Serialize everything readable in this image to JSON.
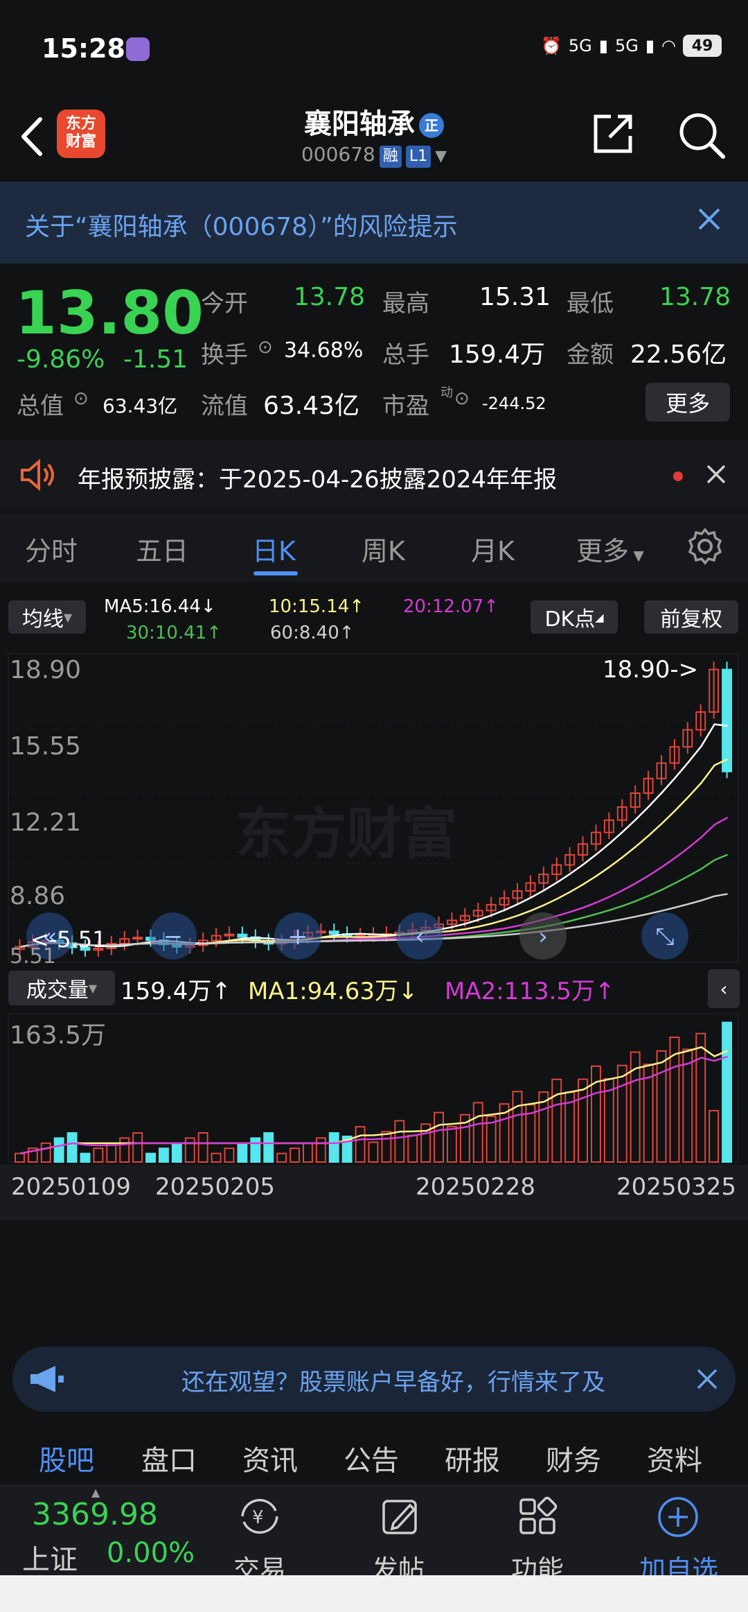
{
  "status_bar": {
    "time": "15:28",
    "battery": "49",
    "signal1": "5G",
    "signal2": "5G"
  },
  "header": {
    "logo": "东方\n财富",
    "stock_name": "襄阳轴承",
    "name_badge": "正",
    "code": "000678",
    "tag_rong": "融",
    "tag_l1": "L1"
  },
  "risk_banner": {
    "text": "关于“襄阳轴承（000678）”的风险提示"
  },
  "quote": {
    "price": "13.80",
    "change_pct": "-9.86%",
    "change_abs": "-1.51",
    "open_label": "今开",
    "open": "13.78",
    "high_label": "最高",
    "high": "15.31",
    "low_label": "最低",
    "low": "13.78",
    "turnover_label": "换手",
    "turnover": "34.68%",
    "volume_label": "总手",
    "volume": "159.4万",
    "amount_label": "金额",
    "amount": "22.56亿",
    "mktcap_label": "总值",
    "mktcap": "63.43亿",
    "float_label": "流值",
    "float": "63.43亿",
    "pe_label": "市盈",
    "pe_sup": "动",
    "pe": "-244.52",
    "more": "更多"
  },
  "notice": {
    "text": "年报预披露：于2025-04-26披露2024年年报"
  },
  "period_tabs": [
    "分时",
    "五日",
    "日K",
    "周K",
    "月K",
    "更多"
  ],
  "ma_bar": {
    "selector": "均线",
    "ma5": "MA5:16.44↓",
    "ma10": "10:15.14↑",
    "ma20": "20:12.07↑",
    "ma30": "30:10.41↑",
    "ma60": "60:8.40↑",
    "dk": "DK点",
    "fq": "前复权"
  },
  "price_axis": {
    "top": "18.90",
    "l2": "15.55",
    "l3": "12.21",
    "l4": "8.86",
    "low": "5.51",
    "max_marker": "18.90->",
    "min_marker": "<-5.51"
  },
  "watermark": "东方财富",
  "vol_bar": {
    "selector": "成交量",
    "vol": "159.4万↑",
    "ma1": "MA1:94.63万↓",
    "ma2": "MA2:113.5万↑",
    "axis_top": "163.5万"
  },
  "dates": [
    "20250109",
    "20250205",
    "20250228",
    "20250325"
  ],
  "colors": {
    "up": "#e0463a",
    "down": "#55e6ee",
    "ma5": "#ffffff",
    "ma10": "#fff38a",
    "ma20": "#d63ad6",
    "ma30": "#4fbf4f",
    "ma60": "#d0d0d0",
    "accent": "#4f8ff7"
  },
  "ad": {
    "text": "还在观望？股票账户早备好，行情来了及"
  },
  "sub_tabs": [
    "股吧",
    "盘口",
    "资讯",
    "公告",
    "研报",
    "财务",
    "资料"
  ],
  "bottom_nav": {
    "index_value": "3369.98",
    "index_name": "上证",
    "index_change": "0.00%",
    "trade": "交易",
    "post": "发帖",
    "func": "功能",
    "add": "加自选"
  }
}
